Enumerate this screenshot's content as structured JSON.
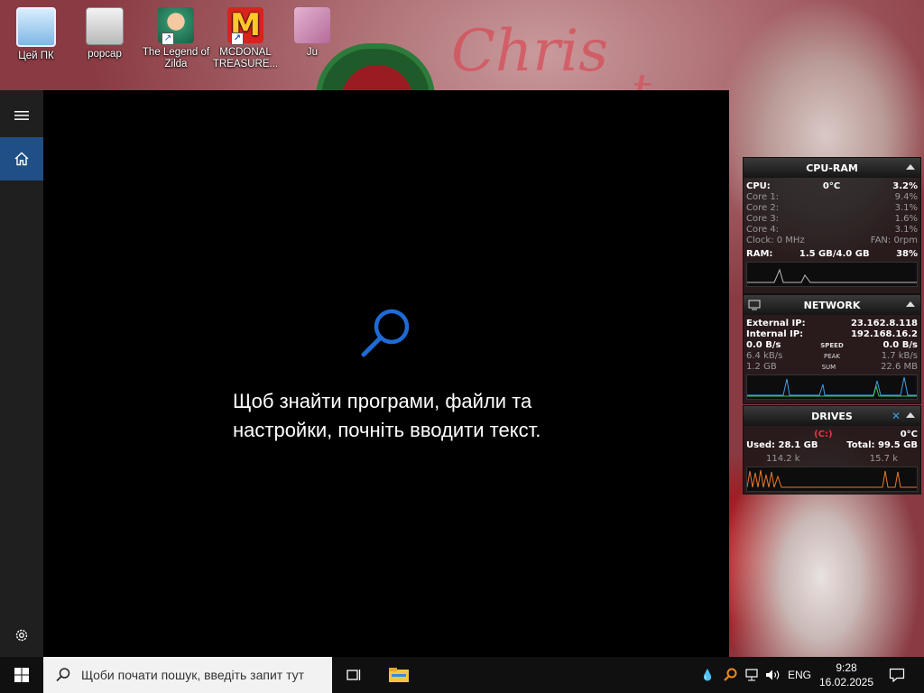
{
  "desktop": {
    "icons": [
      {
        "label": "Цей ПК"
      },
      {
        "label": "popcap"
      },
      {
        "label": "The Legend of Zilda"
      },
      {
        "label": "MCDONAL TREASURE..."
      },
      {
        "label": "Ju"
      }
    ]
  },
  "search_panel": {
    "empty_message": "Щоб знайти програми, файли та настройки, почніть вводити текст."
  },
  "gadgets": {
    "cpu_ram": {
      "title": "CPU-RAM",
      "cpu_label": "CPU:",
      "cpu_temp": "0°C",
      "cpu_value": "3.2%",
      "cores": [
        {
          "label": "Core 1:",
          "value": "9.4%"
        },
        {
          "label": "Core 2:",
          "value": "3.1%"
        },
        {
          "label": "Core 3:",
          "value": "1.6%"
        },
        {
          "label": "Core 4:",
          "value": "3.1%"
        }
      ],
      "clock": "Clock: 0 MHz",
      "fan": "FAN: 0rpm",
      "ram_label": "RAM:",
      "ram_usage": "1.5 GB/4.0 GB",
      "ram_percent": "38%"
    },
    "network": {
      "title": "NETWORK",
      "external_label": "External IP:",
      "external_ip": "23.162.8.118",
      "internal_label": "Internal IP:",
      "internal_ip": "192.168.16.2",
      "speed_down": "0.0 B/s",
      "speed_label": "SPEED",
      "speed_up": "0.0 B/s",
      "peak_down": "6.4 kB/s",
      "peak_label": "PEAK",
      "peak_up": "1.7 kB/s",
      "sum_down": "1.2 GB",
      "sum_label": "SUM",
      "sum_up": "22.6 MB"
    },
    "drives": {
      "title": "DRIVES",
      "drive": "(C:)",
      "temp": "0°C",
      "used": "Used: 28.1 GB",
      "total": "Total: 99.5 GB",
      "read": "114.2 k",
      "write": "15.7 k"
    }
  },
  "taskbar": {
    "search_placeholder": "Щоби почати пошук, введіть запит тут",
    "language": "ENG",
    "time": "9:28",
    "date": "16.02.2025"
  },
  "colors": {
    "accent": "#1f4f86",
    "search_icon": "#1e6bd6",
    "panel_bg": "#000000",
    "taskbar_bg": "#101010"
  }
}
